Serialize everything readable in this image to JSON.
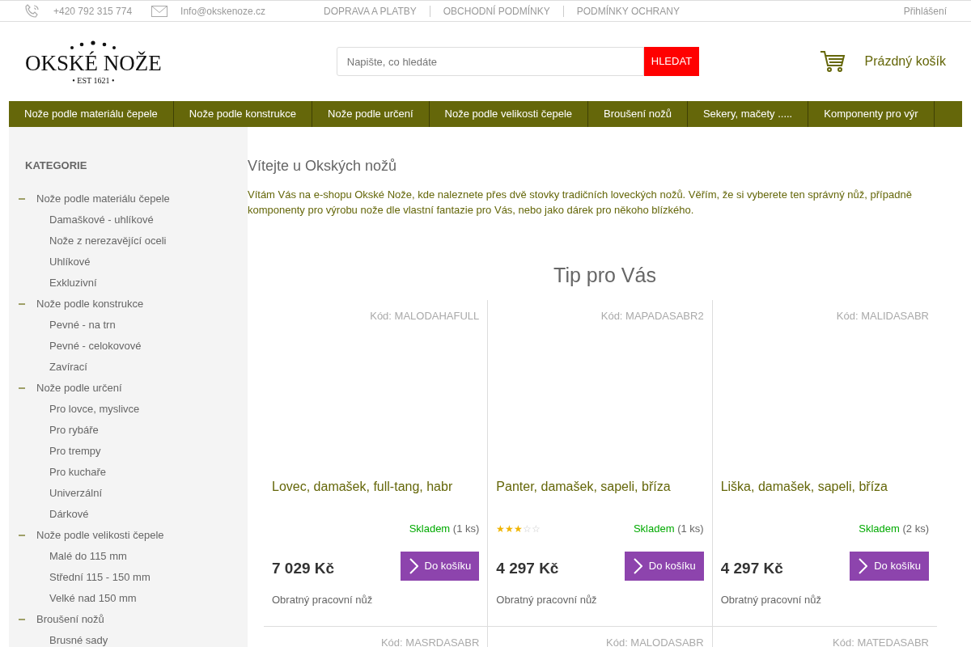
{
  "topbar": {
    "phone": "+420 792 315 774",
    "email": "Info@okskenoze.cz",
    "links": [
      "DOPRAVA A PLATBY",
      "OBCHODNÍ PODMÍNKY",
      "PODMÍNKY OCHRANY"
    ],
    "login": "Přihlášení"
  },
  "logo": {
    "name": "OKSKÉ NOŽE",
    "tagline": "• EST 1621 •"
  },
  "search": {
    "placeholder": "Napište, co hledáte",
    "button": "HLEDAT"
  },
  "cart": {
    "label": "Prázdný košík"
  },
  "menu": [
    "Nože podle materiálu čepele",
    "Nože podle konstrukce",
    "Nože podle určení",
    "Nože podle velikosti čepele",
    "Broušení nožů",
    "Sekery, mačety .....",
    "Komponenty pro výr"
  ],
  "sidebar": {
    "title": "KATEGORIE",
    "items": [
      {
        "label": "Nože podle materiálu čepele",
        "expanded": true,
        "children": [
          {
            "label": "Damaškové - uhlíkové"
          },
          {
            "label": "Nože z nerezavějící oceli"
          },
          {
            "label": "Uhlíkové"
          },
          {
            "label": "Exkluzivní"
          }
        ]
      },
      {
        "label": "Nože podle konstrukce",
        "expanded": true,
        "children": [
          {
            "label": "Pevné - na trn"
          },
          {
            "label": "Pevné - celokovové"
          },
          {
            "label": "Zavírací"
          }
        ]
      },
      {
        "label": "Nože podle určení",
        "expanded": true,
        "children": [
          {
            "label": "Pro lovce, myslivce"
          },
          {
            "label": "Pro rybáře"
          },
          {
            "label": "Pro trempy"
          },
          {
            "label": "Pro kuchaře"
          },
          {
            "label": "Univerzální"
          },
          {
            "label": "Dárkové"
          }
        ]
      },
      {
        "label": "Nože podle velikosti čepele",
        "expanded": true,
        "children": [
          {
            "label": "Malé do 115 mm"
          },
          {
            "label": "Střední 115 - 150 mm"
          },
          {
            "label": "Velké nad 150 mm"
          }
        ]
      },
      {
        "label": "Broušení nožů",
        "expanded": true,
        "children": [
          {
            "label": "Brusné sady"
          }
        ]
      }
    ]
  },
  "welcome": {
    "title": "Vítejte u Okských nožů",
    "text": "Vítám Vás na e-shopu Okské Nože, kde naleznete přes dvě stovky tradičních loveckých nožů. Věřím, že si vyberete ten správný nůž, případně komponenty pro výrobu nože dle vlastní fantazie pro Vás, nebo jako dárek pro někoho blízkého."
  },
  "tip": {
    "title": "Tip pro Vás",
    "products": [
      {
        "code": "Kód: MALODAHAFULL",
        "name": "Lovec, damašek, full-tang, habr",
        "availability": "Skladem",
        "quantity": "(1 ks)",
        "price": "7 029 Kč",
        "button": "Do košíku",
        "description": "Obratný pracovní nůž"
      },
      {
        "code": "Kód: MAPADASABR2",
        "name": "Panter, damašek, sapeli, bříza",
        "stars": 3,
        "availability": "Skladem",
        "quantity": "(1 ks)",
        "price": "4 297 Kč",
        "button": "Do košíku",
        "description": "Obratný pracovní nůž"
      },
      {
        "code": "Kód: MALIDASABR",
        "name": "Liška, damašek, sapeli, bříza",
        "availability": "Skladem",
        "quantity": "(2 ks)",
        "price": "4 297 Kč",
        "button": "Do košíku",
        "description": "Obratný pracovní nůž"
      },
      {
        "code": "Kód: MASRDASABR"
      },
      {
        "code": "Kód: MALODASABR"
      },
      {
        "code": "Kód: MATEDASABR"
      }
    ]
  }
}
